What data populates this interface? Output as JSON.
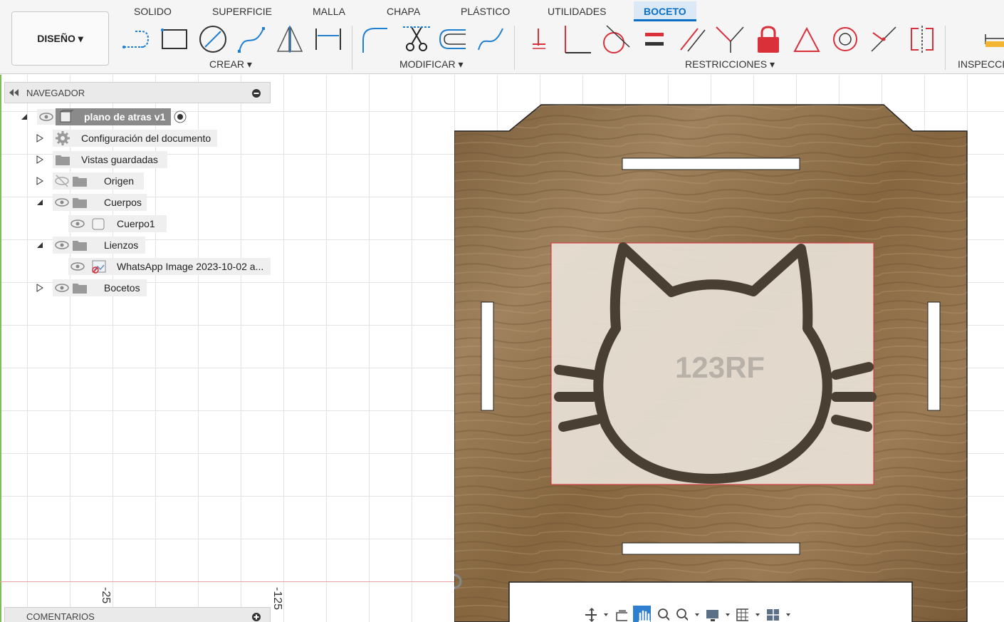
{
  "workspace": {
    "label": "DISEÑO ▾"
  },
  "tabs": [
    {
      "label": "SOLIDO"
    },
    {
      "label": "SUPERFICIE"
    },
    {
      "label": "MALLA"
    },
    {
      "label": "CHAPA"
    },
    {
      "label": "PLÁSTICO"
    },
    {
      "label": "UTILIDADES"
    },
    {
      "label": "BOCETO"
    }
  ],
  "active_tab": "BOCETO",
  "groups": {
    "crear": "CREAR ▾",
    "modificar": "MODIFICAR ▾",
    "restricciones": "RESTRICCIONES ▾",
    "inspeccionar": "INSPECCI"
  },
  "navigator": {
    "title": "NAVEGADOR",
    "root": "plano de atras v1",
    "items": [
      {
        "label": "Configuración del documento"
      },
      {
        "label": "Vistas guardadas"
      },
      {
        "label": "Origen"
      },
      {
        "label": "Cuerpos"
      },
      {
        "label": "Cuerpo1"
      },
      {
        "label": "Lienzos"
      },
      {
        "label": "WhatsApp Image 2023-10-02 a..."
      },
      {
        "label": "Bocetos"
      }
    ]
  },
  "axis_labels": {
    "left": "-25",
    "right": "-125"
  },
  "comments": {
    "title": "COMENTARIOS"
  },
  "canvas": {
    "watermark": "123RF"
  },
  "colors": {
    "accent": "#0b6fc6",
    "constraint_red": "#d9303a",
    "wood": "#8a6a45"
  }
}
